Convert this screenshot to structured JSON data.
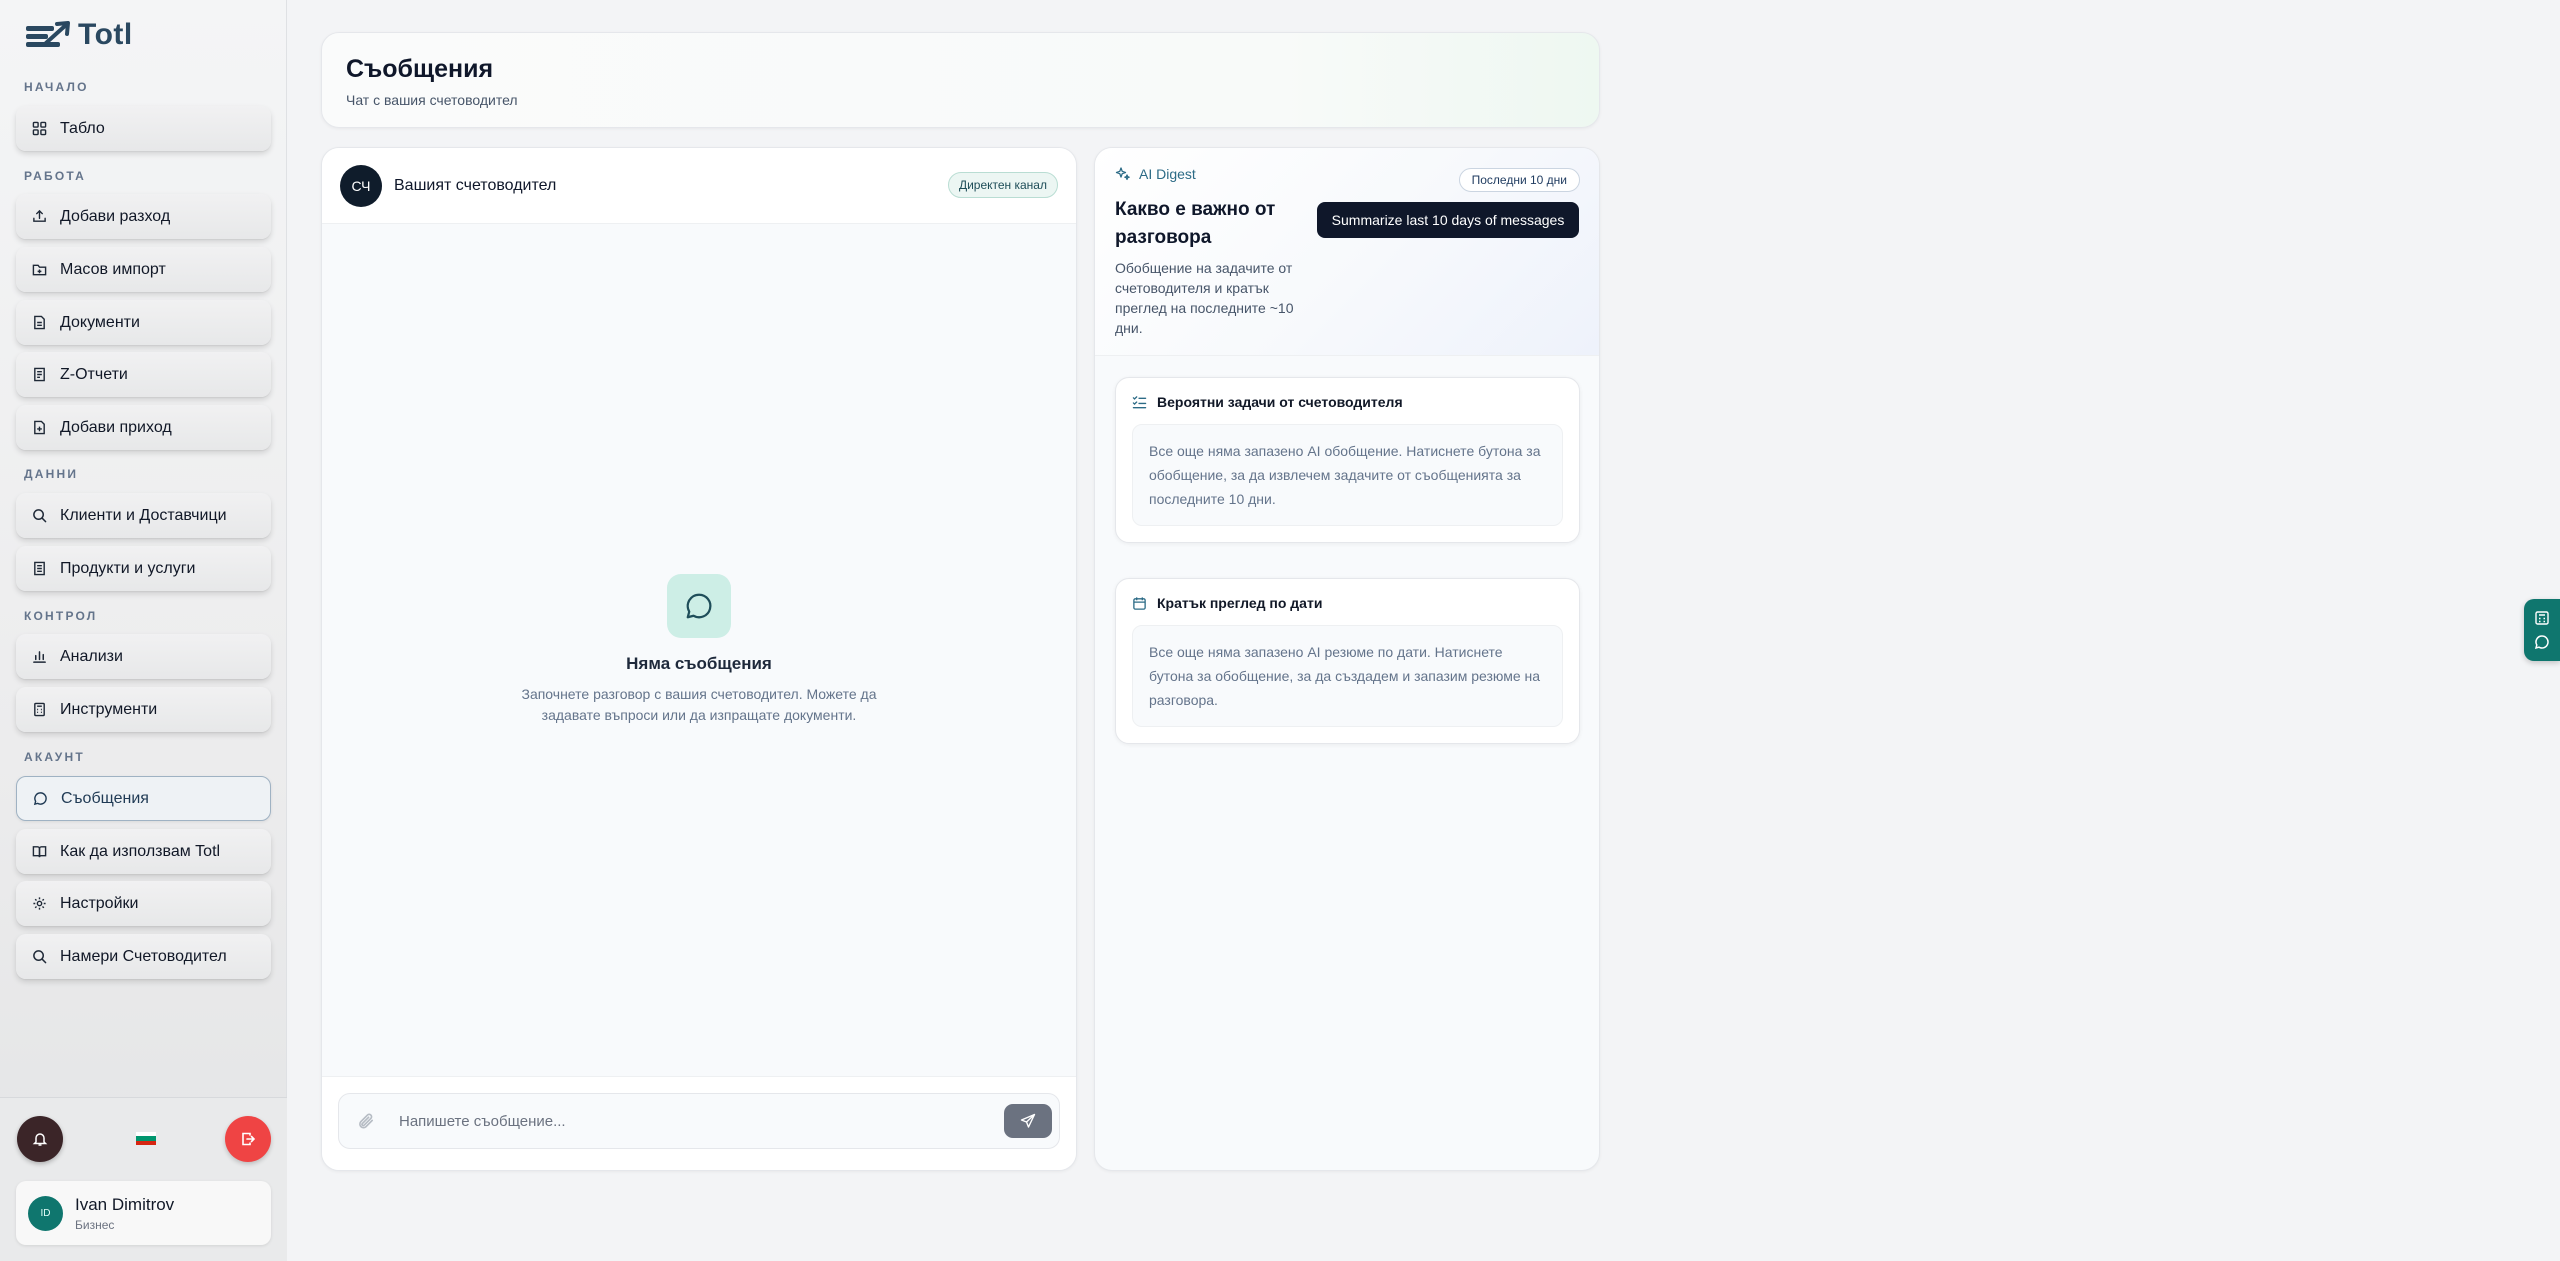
{
  "brand": {
    "name": "Totl"
  },
  "sidebar": {
    "sections": {
      "start": "НАЧАЛО",
      "work": "РАБОТА",
      "data": "ДАННИ",
      "control": "КОНТРОЛ",
      "account": "АКАУНТ"
    },
    "items": {
      "dashboard": "Табло",
      "add_expense": "Добави разход",
      "bulk_import": "Масов импорт",
      "documents": "Документи",
      "z_reports": "Z-Отчети",
      "add_income": "Добави приход",
      "clients": "Клиенти и Доставчици",
      "products": "Продукти и услуги",
      "analytics": "Анализи",
      "tools": "Инструменти",
      "messages": "Съобщения",
      "how_to": "Как да използвам Totl",
      "settings": "Настройки",
      "find_accountant": "Намери Счетоводител"
    },
    "active": "messages"
  },
  "user": {
    "initials": "ID",
    "name": "Ivan Dimitrov",
    "plan": "Бизнес"
  },
  "header": {
    "title": "Съобщения",
    "subtitle": "Чат с вашия счетоводител"
  },
  "chat": {
    "avatar_initials": "СЧ",
    "title": "Вашият счетоводител",
    "channel_badge": "Директен канал",
    "empty_title": "Няма съобщения",
    "empty_text": "Започнете разговор с вашия счетоводител. Можете да задавате въпроси или да изпращате документи.",
    "input_placeholder": "Напишете съобщение..."
  },
  "digest": {
    "tag": "AI Digest",
    "period_badge": "Последни 10 дни",
    "title": "Какво е важно от разговора",
    "description": "Обобщение на задачите от счетоводителя и кратък преглед на последните ~10 дни.",
    "button": "Summarize last 10 days of messages",
    "tasks_title": "Вероятни задачи от счетоводителя",
    "tasks_body": "Все още няма запазено AI обобщение. Натиснете бутона за обобщение, за да извлечем задачите от съобщенията за последните 10 дни.",
    "dates_title": "Кратък преглед по дати",
    "dates_body": "Все още няма запазено AI резюме по дати. Натиснете бутона за обобщение, за да създадем и запазим резюме на разговора."
  },
  "colors": {
    "accent": "#0f766e",
    "dark": "#0f172a",
    "danger": "#ef4444"
  }
}
